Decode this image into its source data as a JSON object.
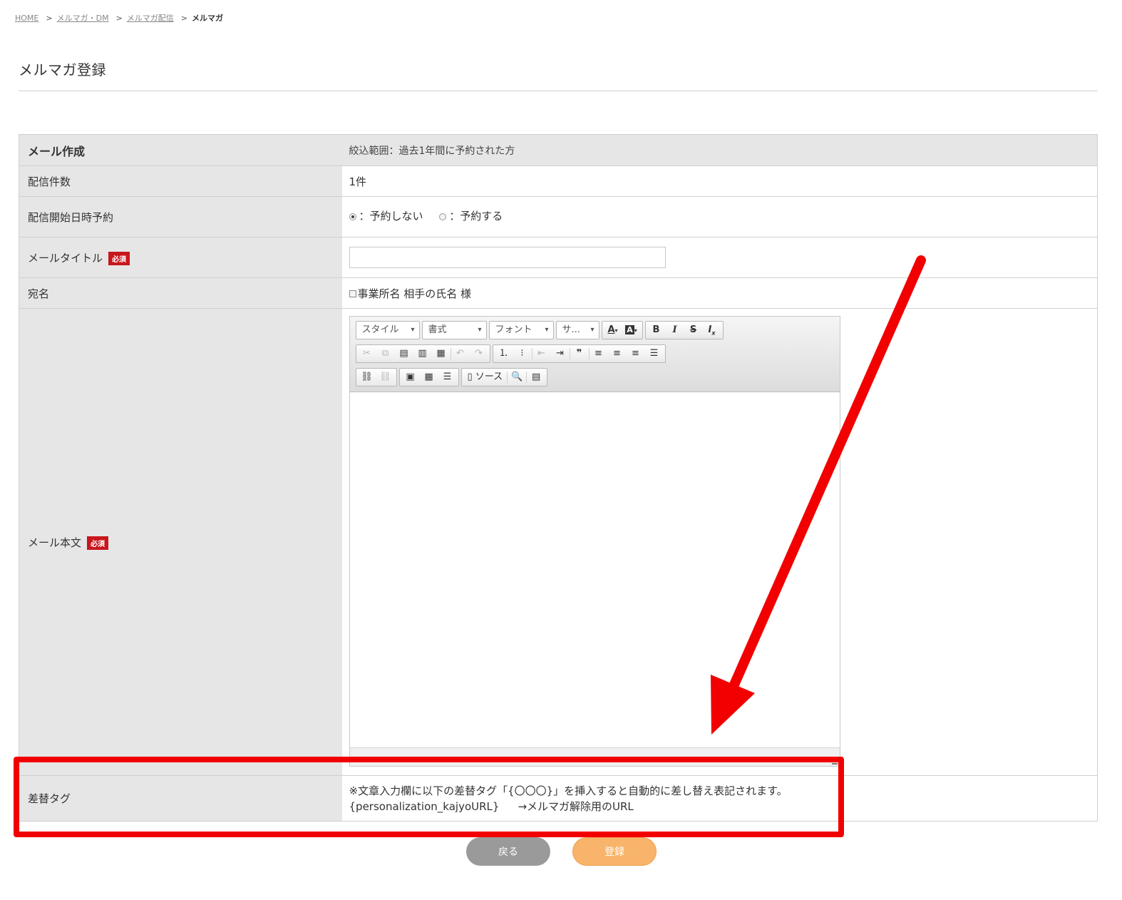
{
  "breadcrumb": {
    "home": "HOME",
    "item1": "メルマガ・DM",
    "item2": "メルマガ配信",
    "current": "メルマガ",
    "sep": ">"
  },
  "page_title": "メルマガ登録",
  "form": {
    "header_label": "メール作成",
    "header_value": "絞込範囲：過去1年間に予約された方",
    "count_label": "配信件数",
    "count_value": "1件",
    "schedule_label": "配信開始日時予約",
    "schedule_options": [
      "：予約しない",
      "：予約する"
    ],
    "schedule_selected": "：予約しない",
    "mail_title_label": "メールタイトル",
    "required_badge": "必須",
    "mail_title_value": "",
    "address_label": "宛名",
    "address_option": "事業所名 相手の氏名 様",
    "body_label": "メール本文",
    "tag_label": "差替タグ",
    "tag_note": "※文章入力欄に以下の差替タグ「{〇〇〇}」を挿入すると自動的に差し替え表記されます。",
    "tag_code": "{personalization_kajyoURL}",
    "tag_desc": "→メルマガ解除用のURL"
  },
  "editor": {
    "combo_style": "スタイル",
    "combo_format": "書式",
    "combo_font": "フォント",
    "combo_size": "サ...",
    "source_label": "ソース",
    "body_value": ""
  },
  "buttons": {
    "back": "戻る",
    "register": "登録"
  },
  "colors": {
    "annotation": "#f20000",
    "required": "#c8161d",
    "back_button": "#9a9a9a",
    "register_button": "#f7b46a"
  }
}
